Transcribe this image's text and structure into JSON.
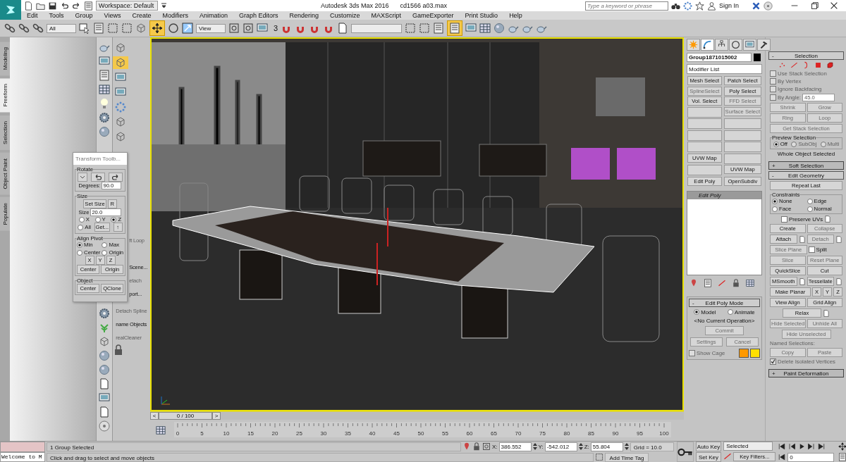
{
  "title_bar": {
    "workspace": "Workspace: Default",
    "app_title": "Autodesk 3ds Max 2016",
    "file_name": "cd1566 a03.max",
    "search": {
      "placeholder": "Type a keyword or phrase"
    },
    "sign_in": "Sign In"
  },
  "menu_bar": [
    "Edit",
    "Tools",
    "Group",
    "Views",
    "Create",
    "Modifiers",
    "Animation",
    "Graph Editors",
    "Rendering",
    "Customize",
    "MAXScript",
    "GameExporter",
    "Print Studio",
    "Help"
  ],
  "main_toolbar": {
    "selection_filter": "All",
    "reference_coordinate": "View",
    "snap_label": "3",
    "move_tool": {
      "selected": true
    },
    "scene_explorer": {
      "selected": true
    }
  },
  "ribbon_tabs": [
    {
      "label": "Modeling",
      "selected": false
    },
    {
      "label": "Freeform",
      "selected": true
    },
    {
      "label": "Selection",
      "selected": false
    },
    {
      "label": "Object Paint",
      "selected": false
    },
    {
      "label": "Populate",
      "selected": false
    }
  ],
  "command_column": [
    {
      "label": "ft Loop",
      "disabled": true
    },
    {
      "label": "Scene...",
      "disabled": false
    },
    {
      "label": "etach",
      "disabled": true
    },
    {
      "label": "port...",
      "disabled": false
    },
    {
      "label": "Detach Spline",
      "disabled": true
    },
    {
      "label": "name Objects",
      "disabled": false
    },
    {
      "label": "realCleaner",
      "disabled": true
    }
  ],
  "transform_toolbox": {
    "title": "Transform Toolb...",
    "rotate": {
      "label": "Rotate",
      "degrees_label": "Degrees:",
      "degrees": "90.0"
    },
    "size": {
      "label": "Size",
      "set_size": "Set Size",
      "reset": "R",
      "size_label": "Size",
      "value": "20.0",
      "axes": [
        {
          "label": "X",
          "selected": false
        },
        {
          "label": "Y",
          "selected": false
        },
        {
          "label": "Z",
          "selected": true
        },
        {
          "label": "All",
          "selected": false
        }
      ],
      "get": "Get...",
      "up": "↑"
    },
    "align_pivot": {
      "label": "Align Pivot",
      "options": [
        {
          "label": "Min",
          "selected": true
        },
        {
          "label": "Max",
          "selected": false
        },
        {
          "label": "Center",
          "selected": false
        },
        {
          "label": "Origin",
          "selected": false
        }
      ],
      "axis_buttons": [
        "X",
        "Y",
        "Z"
      ],
      "buttons": [
        "Center",
        "Origin"
      ]
    },
    "object": {
      "label": "Object",
      "buttons": [
        "Center",
        "QClone"
      ]
    }
  },
  "command_panel": {
    "tabs": [
      {
        "selected": false
      },
      {
        "selected": true
      },
      {
        "selected": false
      },
      {
        "selected": false
      },
      {
        "selected": false
      },
      {
        "selected": false
      }
    ],
    "object_name": "Group1871015002",
    "modifier_list": "Modifier List",
    "modifier_buttons": [
      {
        "kind": "button",
        "label": "Mesh Select",
        "disabled": false
      },
      {
        "kind": "button",
        "label": "Patch Select",
        "disabled": false
      },
      {
        "kind": "button",
        "label": "SplineSelect",
        "disabled": true
      },
      {
        "kind": "button",
        "label": "Poly Select",
        "disabled": false
      },
      {
        "kind": "button",
        "label": "Vol. Select",
        "disabled": false
      },
      {
        "kind": "button",
        "label": "FFD Select",
        "disabled": true
      },
      {
        "kind": "blank"
      },
      {
        "kind": "button",
        "label": "Surface Select",
        "disabled": true
      },
      {
        "kind": "blank"
      },
      {
        "kind": "blank"
      },
      {
        "kind": "blank"
      },
      {
        "kind": "blank"
      },
      {
        "kind": "blank"
      },
      {
        "kind": "blank"
      },
      {
        "kind": "button",
        "label": "UVW Map",
        "disabled": false
      },
      {
        "kind": "blank"
      },
      {
        "kind": "blank"
      },
      {
        "kind": "button",
        "label": "UVW Map",
        "disabled": false
      },
      {
        "kind": "button",
        "label": "Edit Poly",
        "disabled": false
      },
      {
        "kind": "button",
        "label": "OpenSubdiv",
        "disabled": false
      }
    ],
    "modifier_stack": [
      {
        "label": "Edit Poly",
        "selected": true
      }
    ],
    "edit_poly_mode": {
      "sign": "-",
      "title": "Edit Poly Mode",
      "expanded": true,
      "modes": [
        {
          "label": "Model",
          "selected": true
        },
        {
          "label": "Animate",
          "selected": false
        }
      ],
      "operation": "<No Current Operation>",
      "commit": {
        "label": "Commit",
        "disabled": true
      },
      "settings": {
        "label": "Settings",
        "disabled": true
      },
      "cancel": {
        "label": "Cancel",
        "disabled": true
      },
      "show_cage": {
        "label": "Show Cage",
        "checked": false,
        "disabled": true
      }
    }
  },
  "rollouts": [
    {
      "kind": "selection",
      "sign": "-",
      "title": "Selection",
      "expanded": true,
      "checks": [
        {
          "label": "Use Stack Selection",
          "checked": false,
          "disabled": true
        },
        {
          "label": "By Vertex",
          "checked": false,
          "disabled": true
        },
        {
          "label": "Ignore Backfacing",
          "checked": false,
          "disabled": true
        },
        {
          "label": "By Angle:",
          "checked": false,
          "disabled": true
        }
      ],
      "angle": "45.0",
      "buttons": [
        {
          "label": "Shrink",
          "disabled": true
        },
        {
          "label": "Grow",
          "disabled": true
        },
        {
          "label": "Ring",
          "disabled": true
        },
        {
          "label": "Loop",
          "disabled": true
        },
        {
          "label": "Get Stack Selection",
          "disabled": true
        }
      ],
      "preview_label": "Preview Selection",
      "preview": [
        {
          "label": "Off",
          "selected": true,
          "disabled": false
        },
        {
          "label": "SubObj",
          "selected": false,
          "disabled": true
        },
        {
          "label": "Multi",
          "selected": false,
          "disabled": true
        }
      ],
      "status": "Whole Object Selected"
    },
    {
      "sign": "+",
      "title": "Soft Selection",
      "expanded": false
    },
    {
      "kind": "geometry",
      "sign": "-",
      "title": "Edit Geometry",
      "expanded": true,
      "repeat_last": {
        "label": "Repeat Last",
        "disabled": false
      },
      "constraints_label": "Constraints",
      "constraints": [
        {
          "label": "None",
          "selected": true
        },
        {
          "label": "Edge",
          "selected": false
        },
        {
          "label": "Face",
          "selected": false
        },
        {
          "label": "Normal",
          "selected": false
        }
      ],
      "preserve_uvs": {
        "label": "Preserve UVs",
        "checked": false,
        "disabled": false
      },
      "create": {
        "label": "Create",
        "disabled": false
      },
      "collapse": {
        "label": "Collapse",
        "disabled": true
      },
      "attach": {
        "label": "Attach",
        "disabled": false
      },
      "detach": {
        "label": "Detach",
        "disabled": true
      },
      "slice_plane": {
        "label": "Slice Plane",
        "disabled": true
      },
      "split": {
        "label": "Split",
        "checked": false,
        "disabled": false
      },
      "slice": {
        "label": "Slice",
        "disabled": true
      },
      "reset_plane": {
        "label": "Reset Plane",
        "disabled": true
      },
      "quickslice": {
        "label": "QuickSlice",
        "disabled": false
      },
      "cut": {
        "label": "Cut",
        "disabled": false
      },
      "msmooth": {
        "label": "MSmooth",
        "disabled": false
      },
      "tessellate": {
        "label": "Tessellate",
        "disabled": false
      },
      "make_planar": {
        "label": "Make Planar",
        "disabled": false
      },
      "axes": [
        "X",
        "Y",
        "Z"
      ],
      "view_align": {
        "label": "View Align",
        "disabled": false
      },
      "grid_align": {
        "label": "Grid Align",
        "disabled": false
      },
      "relax": {
        "label": "Relax",
        "disabled": false
      },
      "hide_selected": {
        "label": "Hide Selected",
        "disabled": true
      },
      "unhide_all": {
        "label": "Unhide All",
        "disabled": true
      },
      "hide_unselected": {
        "label": "Hide Unselected",
        "disabled": true
      },
      "named_selections": "Named Selections:",
      "copy": {
        "label": "Copy",
        "disabled": true
      },
      "paste": {
        "label": "Paste",
        "disabled": true
      },
      "delete_isolated": {
        "label": "Delete Isolated Vertices",
        "checked": true,
        "disabled": true
      }
    },
    {
      "sign": "+",
      "title": "Paint Deformation",
      "expanded": false
    }
  ],
  "time_slider": {
    "prev": "<",
    "position": "0 / 100",
    "next": ">"
  },
  "track_bar": {
    "ticks": [
      "0",
      "5",
      "10",
      "15",
      "20",
      "25",
      "30",
      "35",
      "40",
      "45",
      "50",
      "55",
      "60",
      "65",
      "70",
      "75",
      "80",
      "85",
      "90",
      "95",
      "100"
    ]
  },
  "status_bar": {
    "listener": "Welcome to M",
    "selection": "1 Group Selected",
    "prompt": "Click and drag to select and move objects",
    "coords": [
      {
        "label": "X:",
        "value": "386.552"
      },
      {
        "label": "Y:",
        "value": "-542.012"
      },
      {
        "label": "Z:",
        "value": "55.804"
      }
    ],
    "grid": "Grid = 10.0",
    "add_time_tag": "Add Time Tag",
    "auto_key": "Auto Key",
    "set_key": "Set Key",
    "key_mode": "Selected",
    "key_filters": "Key Filters...",
    "frame": "0"
  }
}
